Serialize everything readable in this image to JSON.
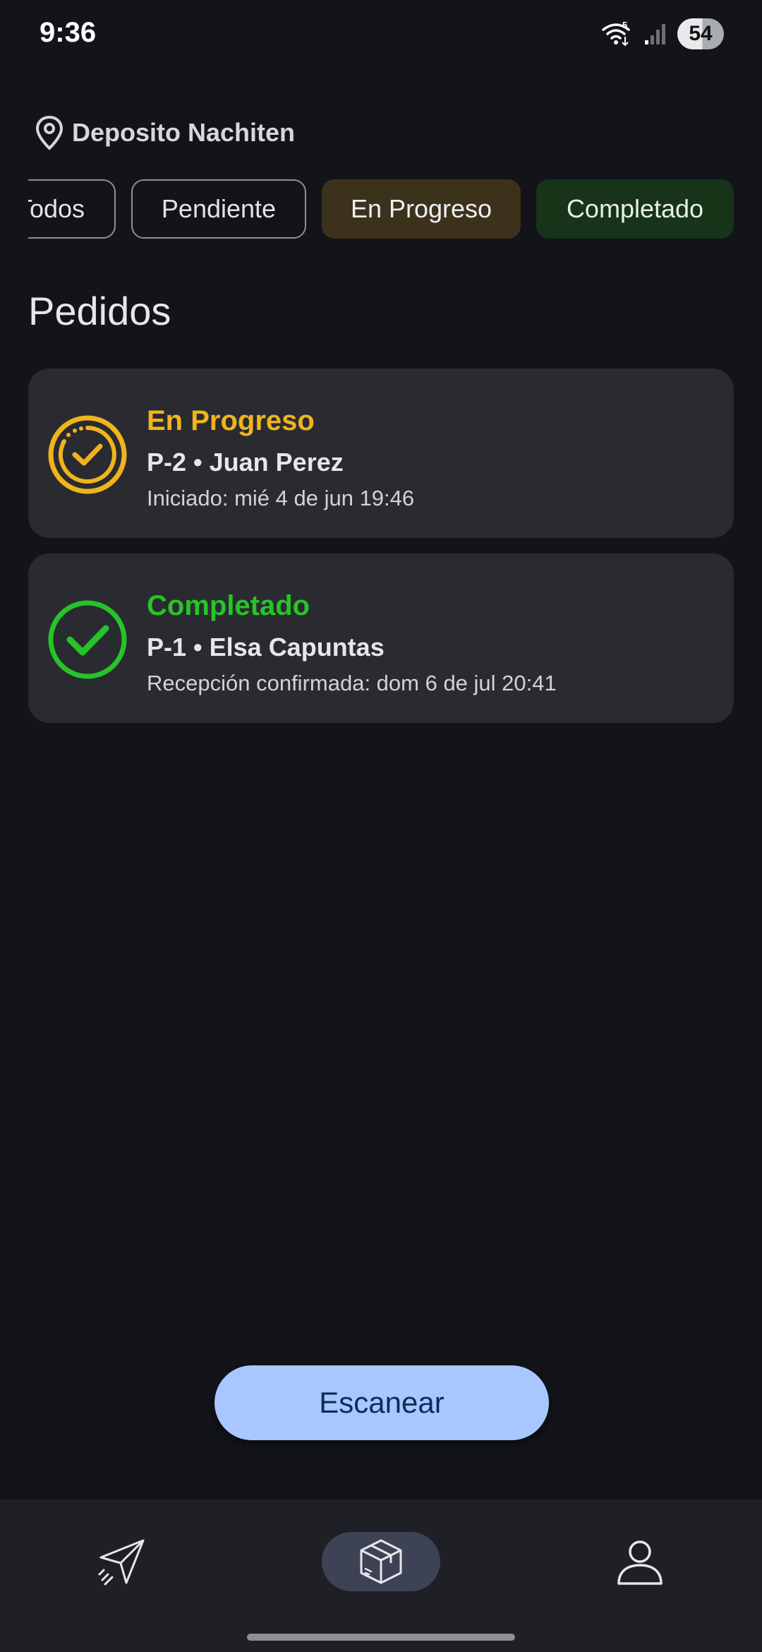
{
  "status_bar": {
    "time": "9:36",
    "battery": "54",
    "wifi_badge": "5",
    "icons": [
      "wifi-icon",
      "signal-icon",
      "battery-icon"
    ]
  },
  "location": {
    "icon": "location-pin-icon",
    "label": "Deposito Nachiten"
  },
  "filters": [
    {
      "label": "Todos",
      "state": "outline"
    },
    {
      "label": "Pendiente",
      "state": "outline"
    },
    {
      "label": "En Progreso",
      "state": "tinted"
    },
    {
      "label": "Completado",
      "state": "tinted"
    }
  ],
  "section_title": "Pedidos",
  "orders": [
    {
      "status": "En Progreso",
      "title": "P-2 • Juan Perez",
      "detail": "Iniciado: mié 4 de jun 19:46",
      "icon": "progress-check-icon",
      "color": "#F0B41C"
    },
    {
      "status": "Completado",
      "title": "P-1 • Elsa Capuntas",
      "detail": "Recepción confirmada: dom 6 de jul 20:41",
      "icon": "check-circle-icon",
      "color": "#27C427"
    }
  ],
  "scan_button": {
    "label": "Escanear"
  },
  "bottom_nav": [
    {
      "icon": "send-icon",
      "active": false
    },
    {
      "icon": "package-icon",
      "active": true
    },
    {
      "icon": "profile-icon",
      "active": false
    }
  ],
  "colors": {
    "background": "#12141A",
    "card": "#2A2B31",
    "accent": "#A9C7FF",
    "nav": "#1E2026"
  }
}
